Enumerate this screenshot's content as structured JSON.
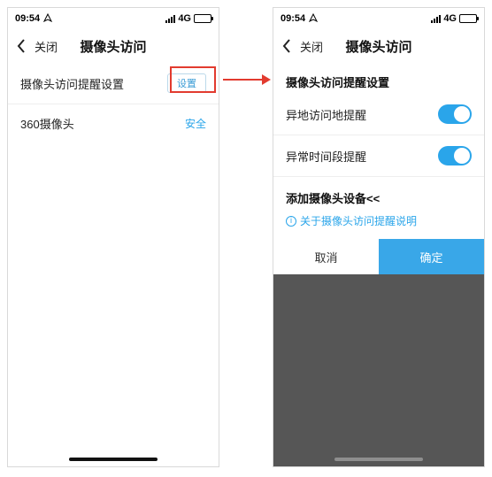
{
  "status": {
    "time": "09:54",
    "net": "4G"
  },
  "nav": {
    "close": "关闭",
    "title": "摄像头访问"
  },
  "left": {
    "row1_label": "摄像头访问提醒设置",
    "settings_btn": "设置",
    "row2_label": "360摄像头",
    "row2_value": "安全"
  },
  "right": {
    "header": "摄像头访问提醒设置",
    "toggle1": "异地访问地提醒",
    "toggle2": "异常时间段提醒",
    "add_device": "添加摄像头设备<<",
    "info_link": "关于摄像头访问提醒说明",
    "cancel": "取消",
    "confirm": "确定"
  }
}
